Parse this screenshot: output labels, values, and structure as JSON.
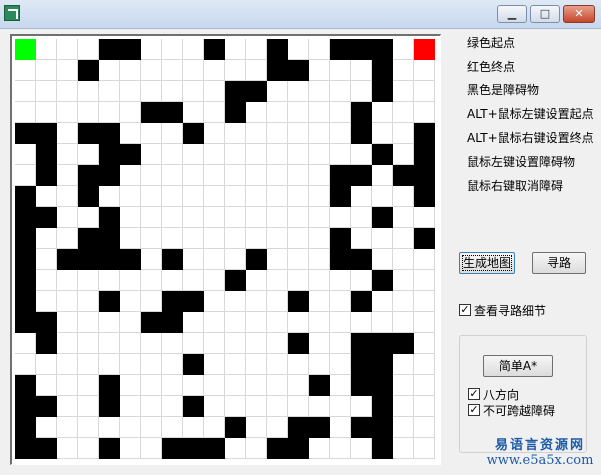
{
  "window": {
    "minimize_label": "▁",
    "maximize_label": "□",
    "close_label": "✕"
  },
  "colors": {
    "start": "#00ff00",
    "end": "#ff0000",
    "obstacle": "#000000",
    "empty": "#ffffff"
  },
  "grid": {
    "rows": [
      "S...##...#..#..###.E",
      "...#........##...#..",
      "..........##.....#..",
      "......##..#.....#...",
      "##.##...#.......#..#",
      ".#..##...........#.#",
      ".#.##..........##.###",
      "#..#...........#...#",
      "##..#............#..",
      "#..##..........#...#",
      "#.####.#...#...##...",
      "#.........#......#..",
      "#...#..##....#..#...",
      "##....##............",
      ".#...........#..###.",
      "........#.......##..",
      "#...#.........#.##..",
      "##..#...#........#..",
      "#.........#..##.##..",
      "##..#..###..##...#..",
      "###......#.......#..",
      "###....##.##.#.#.#..",
      ".##.#.....##.....#..",
      "#.##.......#..##.##."
    ]
  },
  "legend": {
    "green_start": "绿色起点",
    "red_end": "红色终点",
    "black_obstacle": "黑色是障碍物",
    "alt_left": "ALT+鼠标左键设置起点",
    "alt_right": "ALT+鼠标右键设置终点",
    "left_click": "鼠标左键设置障碍物",
    "right_click": "鼠标右键取消障碍"
  },
  "buttons": {
    "generate_map": "生成地图",
    "find_path": "寻路",
    "simple_astar": "简单A*"
  },
  "options": {
    "view_details": {
      "label": "查看寻路细节",
      "checked": true
    },
    "eight_dir": {
      "label": "八方向",
      "checked": true
    },
    "no_cross": {
      "label": "不可跨越障碍",
      "checked": true
    }
  },
  "watermark": {
    "line1": "易语言资源网",
    "line2": "www.e5a5x.com"
  }
}
